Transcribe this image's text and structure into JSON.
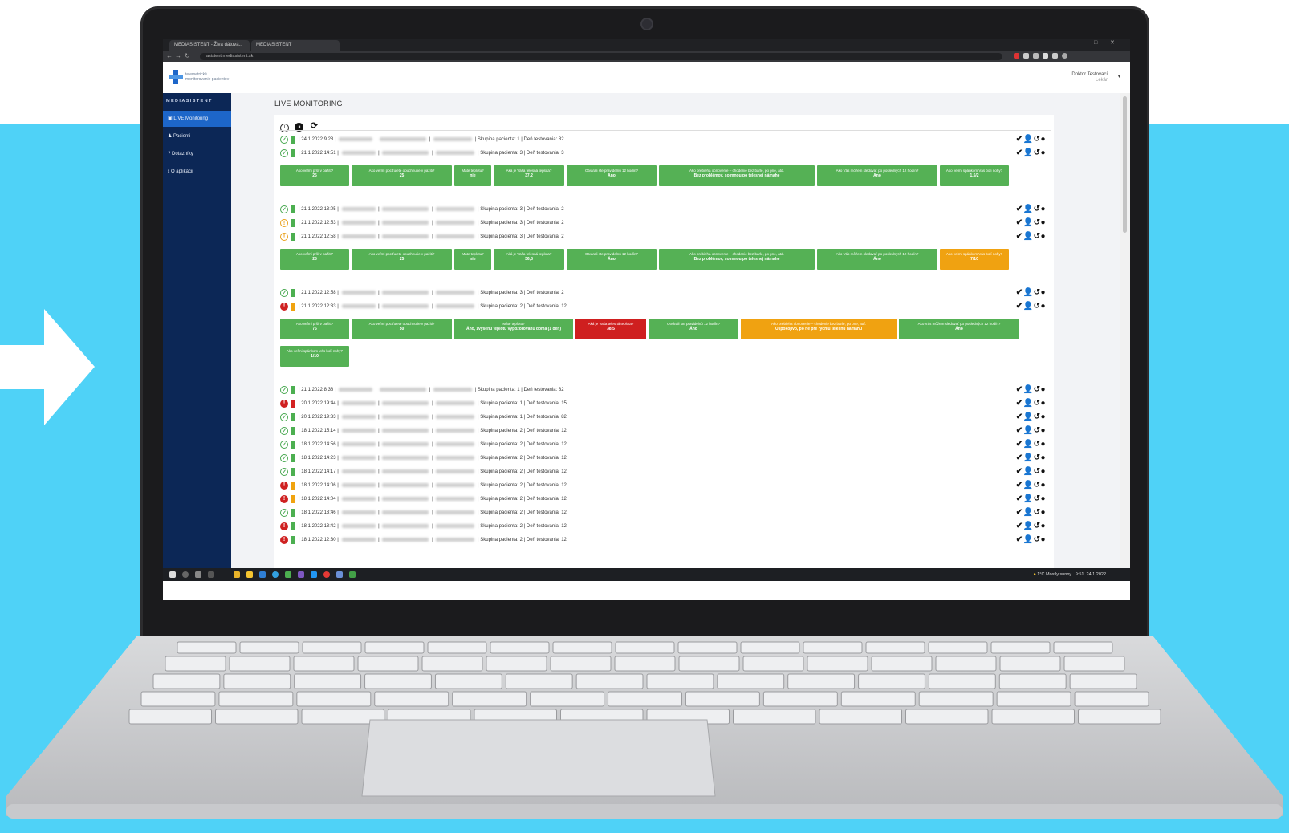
{
  "browser": {
    "tabs": [
      "MEDIASISTENT - Živá dátová..",
      "MEDIASISTENT"
    ],
    "url": "asistent.mediasistent.sk"
  },
  "app": {
    "logo_text_1": "telemetrické",
    "logo_text_2": "monitorovanie pacientov",
    "brand": "MEDIASISTENT",
    "user_name": "Doktor Testovací",
    "user_role": "Lekár"
  },
  "sidebar": {
    "items": [
      {
        "label": "LIVE Monitoring",
        "icon": "monitor-icon"
      },
      {
        "label": "Pacienti",
        "icon": "user-icon"
      },
      {
        "label": "Dotazníky",
        "icon": "question-icon"
      },
      {
        "label": "O aplikácii",
        "icon": "info-icon"
      }
    ]
  },
  "page": {
    "title": "LIVE MONITORING"
  },
  "groups": [
    {
      "rows": [
        {
          "status": "ok",
          "level": "green",
          "datetime": "24.1.2022 9:28",
          "group": "Skupina pacienta: 1",
          "day": "Deň testovania: 82"
        },
        {
          "status": "ok",
          "level": "green",
          "datetime": "21.1.2022 14:51",
          "group": "Skupina pacienta: 3",
          "day": "Deň testovania: 3"
        }
      ],
      "questions": [
        {
          "text": "Ako veľmi prší v pažiti?",
          "value": "25",
          "color": "g"
        },
        {
          "text": "Ako veľmi pociťujete opuchnutie v pažiti?",
          "value": "25",
          "color": "g"
        },
        {
          "text": "Máte teplotu?",
          "value": "nie",
          "color": "g"
        },
        {
          "text": "Aká je Vaša telesná teplota?",
          "value": "37,2",
          "color": "g"
        },
        {
          "text": "Otvárali ste pravidelnú 12 hodín?",
          "value": "Áno",
          "color": "g"
        },
        {
          "text": "Ako prebieha obnovenie – chodenie bez barle, po pne, atď.",
          "value": "Bez problémov, so mnou po telesnej námahe",
          "color": "g"
        },
        {
          "text": "Ako Vás môžem sledovať po posledných 12 hodín?",
          "value": "Áno",
          "color": "g"
        },
        {
          "text": "Ako veľmi spánkom Vás bolí nohy?",
          "value": "1,5/2",
          "color": "g"
        }
      ]
    },
    {
      "rows": [
        {
          "status": "ok",
          "level": "green",
          "datetime": "21.1.2022 13:05",
          "group": "Skupina pacienta: 3",
          "day": "Deň testovania: 2"
        },
        {
          "status": "warn",
          "level": "green",
          "datetime": "21.1.2022 12:53",
          "group": "Skupina pacienta: 3",
          "day": "Deň testovania: 2"
        },
        {
          "status": "warn",
          "level": "green",
          "datetime": "21.1.2022 12:58",
          "group": "Skupina pacienta: 3",
          "day": "Deň testovania: 2"
        }
      ],
      "questions": [
        {
          "text": "Ako veľmi prší v pažiti?",
          "value": "25",
          "color": "g"
        },
        {
          "text": "Ako veľmi pociťujete opuchnutie v pažiti?",
          "value": "25",
          "color": "g"
        },
        {
          "text": "Máte teplotu?",
          "value": "nie",
          "color": "g"
        },
        {
          "text": "Aká je Vaša telesná teplota?",
          "value": "36,8",
          "color": "g"
        },
        {
          "text": "Otvárali ste pravidelnú 12 hodín?",
          "value": "Áno",
          "color": "g"
        },
        {
          "text": "Ako prebieha obnovenie – chodenie bez barle, po pne, atď.",
          "value": "Bez problémov, so mnou po telesnej námahe",
          "color": "g"
        },
        {
          "text": "Ako Vás môžem sledovať po posledných 12 hodín?",
          "value": "Áno",
          "color": "g"
        },
        {
          "text": "Ako veľmi spánkom Vás bolí nohy?",
          "value": "7/10",
          "color": "o"
        }
      ]
    },
    {
      "rows": [
        {
          "status": "ok",
          "level": "green",
          "datetime": "21.1.2022 12:58",
          "group": "Skupina pacienta: 3",
          "day": "Deň testovania: 2"
        },
        {
          "status": "bad",
          "level": "orange",
          "datetime": "21.1.2022 12:33",
          "group": "Skupina pacienta: 2",
          "day": "Deň testovania: 12"
        }
      ],
      "questions": [
        {
          "text": "Ako veľmi prší v pažiti?",
          "value": "75",
          "color": "g"
        },
        {
          "text": "Ako veľmi pociťujete opuchnutie v pažiti?",
          "value": "50",
          "color": "g"
        },
        {
          "text": "Máte teplotu?",
          "value": "Áno, zvýšenú teplotu vypozorovanú doma (1 deň)",
          "color": "g"
        },
        {
          "text": "Aká je Vaša telesná teplota?",
          "value": "38,5",
          "color": "r"
        },
        {
          "text": "Otvárali ste pravidelnú 12 hodín?",
          "value": "Áno",
          "color": "g"
        },
        {
          "text": "Ako prebieha obnovenie – chodenie bez barle, po pne, atď.",
          "value": "Uspokojivo, po ne pre rýchlu telesnú námahu",
          "color": "o"
        },
        {
          "text": "Ako Vás môžem sledovať po posledných 12 hodín?",
          "value": "Áno",
          "color": "g"
        },
        {
          "text": "Ako veľmi spánkom Vás bolí nohy?",
          "value": "1/10",
          "color": "g"
        }
      ]
    }
  ],
  "list_rows": [
    {
      "status": "ok",
      "level": "green",
      "datetime": "21.1.2022 8:38",
      "group": "Skupina pacienta: 1",
      "day": "Deň testovania: 82"
    },
    {
      "status": "bad",
      "level": "red",
      "datetime": "20.1.2022 19:44",
      "group": "Skupina pacienta: 1",
      "day": "Deň testovania: 15"
    },
    {
      "status": "ok",
      "level": "green",
      "datetime": "20.1.2022 19:33",
      "group": "Skupina pacienta: 1",
      "day": "Deň testovania: 82"
    },
    {
      "status": "ok",
      "level": "green",
      "datetime": "18.1.2022 15:14",
      "group": "Skupina pacienta: 2",
      "day": "Deň testovania: 12"
    },
    {
      "status": "ok",
      "level": "green",
      "datetime": "18.1.2022 14:56",
      "group": "Skupina pacienta: 2",
      "day": "Deň testovania: 12"
    },
    {
      "status": "ok",
      "level": "green",
      "datetime": "18.1.2022 14:23",
      "group": "Skupina pacienta: 2",
      "day": "Deň testovania: 12"
    },
    {
      "status": "ok",
      "level": "green",
      "datetime": "18.1.2022 14:17",
      "group": "Skupina pacienta: 2",
      "day": "Deň testovania: 12"
    },
    {
      "status": "bad",
      "level": "orange",
      "datetime": "18.1.2022 14:06",
      "group": "Skupina pacienta: 2",
      "day": "Deň testovania: 12"
    },
    {
      "status": "bad",
      "level": "orange",
      "datetime": "18.1.2022 14:04",
      "group": "Skupina pacienta: 2",
      "day": "Deň testovania: 12"
    },
    {
      "status": "ok",
      "level": "green",
      "datetime": "18.1.2022 13:46",
      "group": "Skupina pacienta: 2",
      "day": "Deň testovania: 12"
    },
    {
      "status": "bad",
      "level": "green",
      "datetime": "18.1.2022 13:42",
      "group": "Skupina pacienta: 2",
      "day": "Deň testovania: 12"
    },
    {
      "status": "bad",
      "level": "green",
      "datetime": "18.1.2022 12:30",
      "group": "Skupina pacienta: 2",
      "day": "Deň testovania: 12"
    }
  ],
  "row_actions": "✔👤↺●",
  "taskbar": {
    "weather": "1°C Mostly sunny",
    "time": "9:51",
    "date": "24.1.2022"
  },
  "colors": {
    "background_band": "#4fd2f7",
    "sidebar": "#0c2756",
    "active_nav": "#1d66c9",
    "ok_green": "#55b155",
    "warn_orange": "#f0a211",
    "alert_red": "#cf1f1f"
  }
}
